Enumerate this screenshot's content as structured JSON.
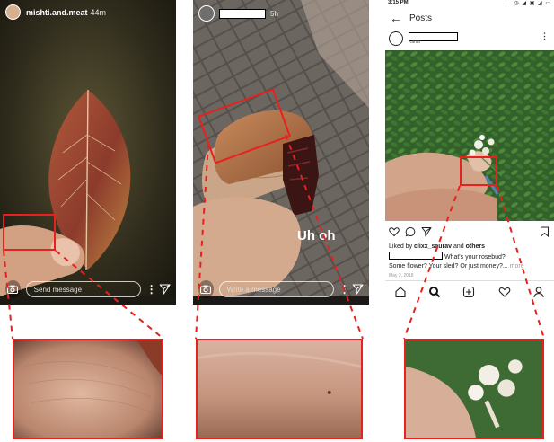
{
  "phone1": {
    "username": "mishti.and.meat",
    "time": "44m",
    "message_placeholder": "Send message"
  },
  "phone2": {
    "time": "5h",
    "overlay_text": "Uh oh",
    "message_placeholder": "Write a message"
  },
  "phone3": {
    "status_time": "3:15 PM",
    "status_icons": "… ◷ ◢ ▣ ◢ ▭",
    "header_title": "Posts",
    "location": "Karan",
    "likes_prefix": "Liked by ",
    "likes_user": "clixx_saurav",
    "likes_joiner": " and ",
    "likes_others": "others",
    "caption_line1": "What's your rosebud?",
    "caption_line2": "Some flower? Your sled? Or just money?...",
    "more_label": "more",
    "date": "May 2, 2018"
  },
  "icons": [
    "back-arrow-icon",
    "more-icon",
    "heart-icon",
    "comment-icon",
    "share-icon",
    "bookmark-icon",
    "home-icon",
    "search-icon",
    "add-icon",
    "profile-icon",
    "camera-icon",
    "send-icon"
  ],
  "colors": {
    "highlight": "#e8201e"
  }
}
